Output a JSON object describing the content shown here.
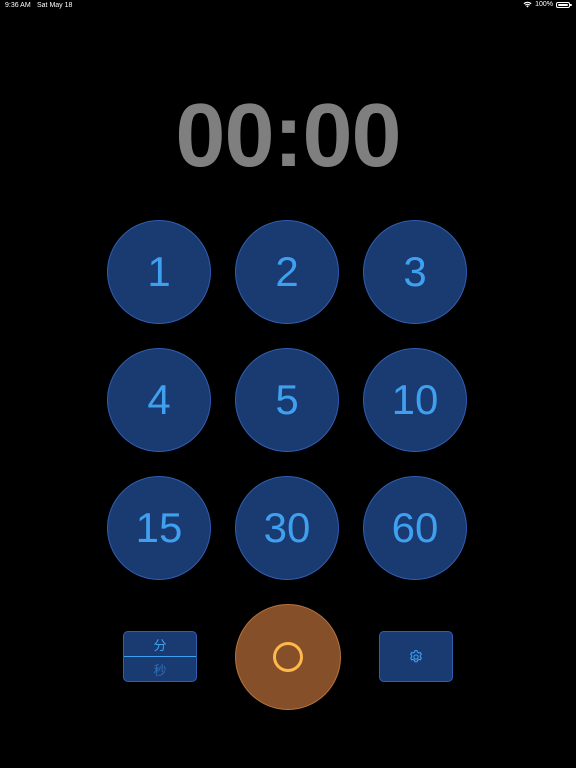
{
  "status_bar": {
    "time": "9:36 AM",
    "date": "Sat May 18",
    "battery_percent": "100%",
    "battery_level": 1.0,
    "wifi_icon": "wifi-icon",
    "battery_icon": "battery-icon"
  },
  "timer": {
    "display": "00:00"
  },
  "keypad": {
    "buttons": [
      "1",
      "2",
      "3",
      "4",
      "5",
      "10",
      "15",
      "30",
      "60"
    ]
  },
  "unit_toggle": {
    "top_label": "分",
    "bottom_label": "秒",
    "selected": "分"
  },
  "start_button": {
    "icon": "circle-ring-icon"
  },
  "settings_button": {
    "icon": "gear-icon"
  },
  "colors": {
    "background": "#000000",
    "timer_text": "#7f7f7f",
    "button_fill": "#1a3a72",
    "button_border": "#2e5fb0",
    "button_text": "#3fa0ef",
    "start_fill": "#854f2a",
    "start_ring": "#ffb84a"
  }
}
